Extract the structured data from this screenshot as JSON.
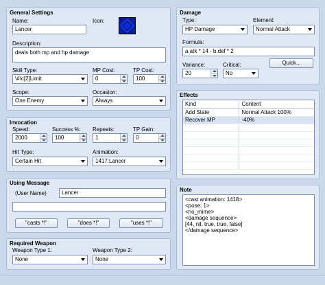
{
  "general": {
    "title": "General Settings",
    "name_label": "Name:",
    "name_value": "Lancer",
    "icon_label": "Icon:",
    "desc_label": "Description:",
    "desc_value": "deals both mp and hp damage",
    "skilltype_label": "Skill Type:",
    "skilltype_value": "\\#\\c[2]Limit",
    "mpcost_label": "MP Cost:",
    "mpcost_value": "0",
    "tpcost_label": "TP Cost:",
    "tpcost_value": "100",
    "scope_label": "Scope:",
    "scope_value": "One Enemy",
    "occasion_label": "Occasion:",
    "occasion_value": "Always",
    "icon_color": "#0a1f8f"
  },
  "invocation": {
    "title": "Invocation",
    "speed_label": "Speed:",
    "speed_value": "2000",
    "success_label": "Success %:",
    "success_value": "100",
    "repeats_label": "Repeats:",
    "repeats_value": "1",
    "tpgain_label": "TP Gain:",
    "tpgain_value": "0",
    "hittype_label": "Hit Type:",
    "hittype_value": "Certain Hit",
    "animation_label": "Animation:",
    "animation_value": "1417:Lancer"
  },
  "message": {
    "title": "Using Message",
    "user_label": "(User Name)",
    "line1_value": "Lancer",
    "line2_value": "",
    "btn_casts": "\"casts *!\"",
    "btn_does": "\"does *!\"",
    "btn_uses": "\"uses *!\""
  },
  "weapon": {
    "title": "Required Weapon",
    "type1_label": "Weapon Type 1:",
    "type1_value": "None",
    "type2_label": "Weapon Type 2:",
    "type2_value": "None"
  },
  "damage": {
    "title": "Damage",
    "type_label": "Type:",
    "type_value": "HP Damage",
    "element_label": "Element:",
    "element_value": "Normal Attack",
    "formula_label": "Formula:",
    "formula_value": "a.atk * 14 - b.def * 2",
    "variance_label": "Variance:",
    "variance_value": "20",
    "critical_label": "Critical:",
    "critical_value": "No",
    "quick_label": "Quick..."
  },
  "effects": {
    "title": "Effects",
    "col_kind": "Kind",
    "col_content": "Content",
    "rows": [
      {
        "kind": "Add State",
        "content": "Normal Attack 100%"
      },
      {
        "kind": "Recover MP",
        "content": "-40%"
      }
    ]
  },
  "note": {
    "title": "Note",
    "text": "<cast animation: 1418>\n<pose: 1>\n<no_mime>\n<damage sequence>\n[44, nil, true, true, false]\n</damage sequence>"
  }
}
